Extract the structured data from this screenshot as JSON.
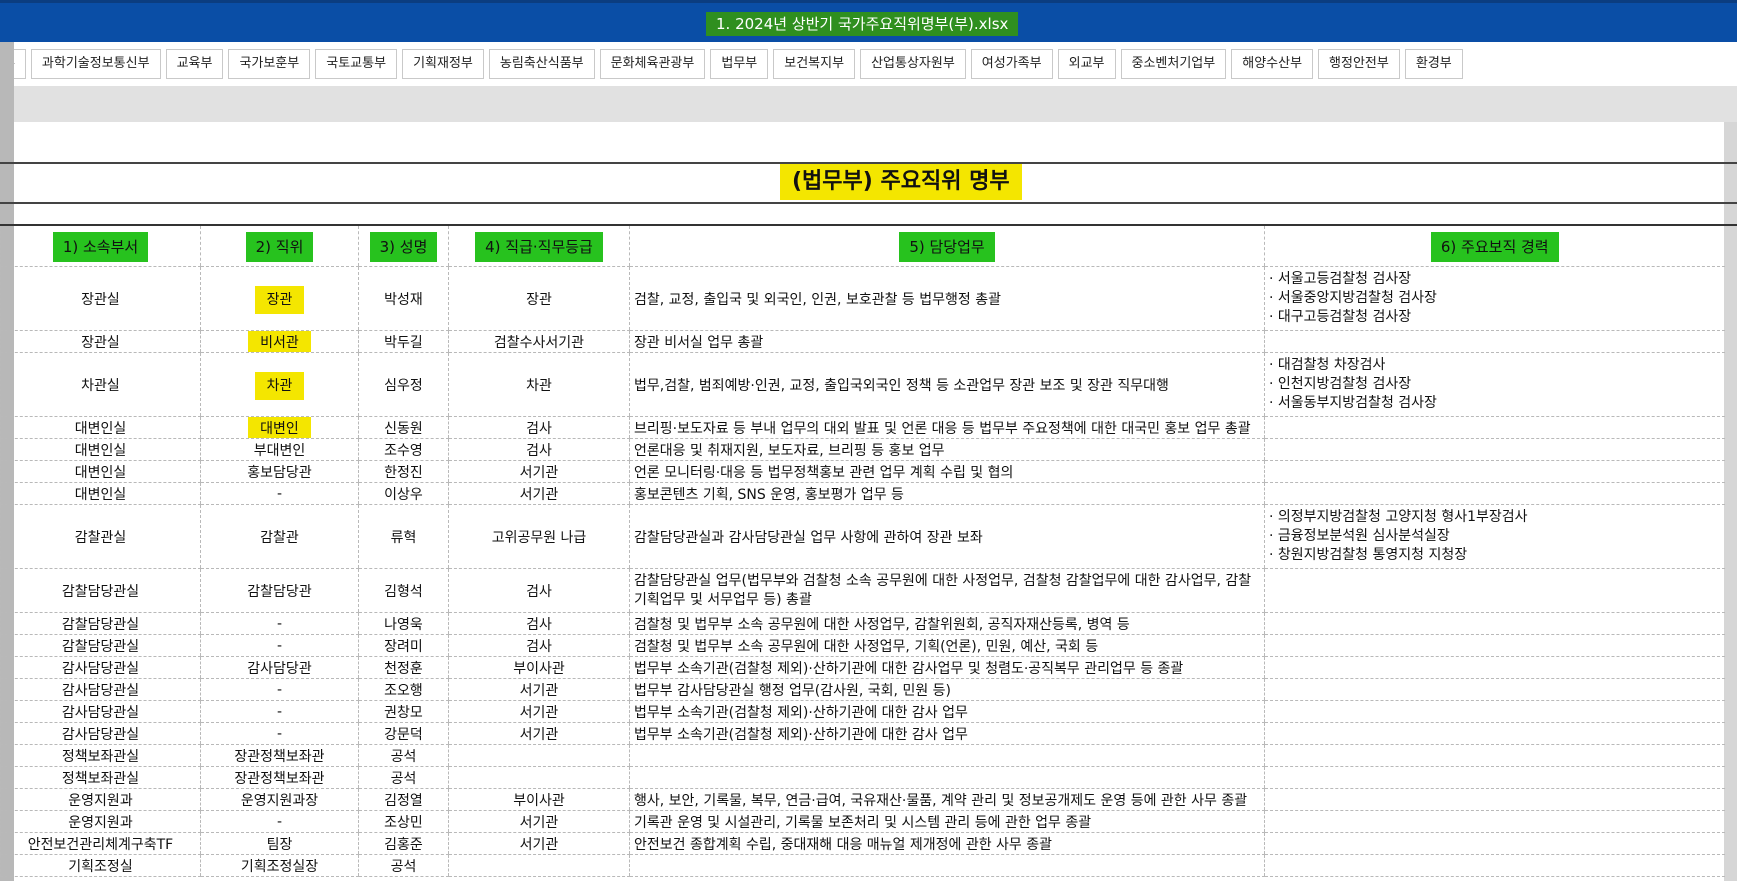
{
  "window": {
    "title": "1. 2024년 상반기 국가주요직위명부(부).xlsx"
  },
  "tabs": [
    "동부",
    "과학기술정보통신부",
    "교육부",
    "국가보훈부",
    "국토교통부",
    "기획재정부",
    "농림축산식품부",
    "문화체육관광부",
    "법무부",
    "보건복지부",
    "산업통상자원부",
    "여성가족부",
    "외교부",
    "중소벤처기업부",
    "해양수산부",
    "행정안전부",
    "환경부"
  ],
  "sheet": {
    "heading": "(법무부) 주요직위 명부"
  },
  "columns": [
    "1) 소속부서",
    "2) 직위",
    "3) 성명",
    "4) 직급·직무등급",
    "5) 담당업무",
    "6) 주요보직 경력"
  ],
  "colors": {
    "header_highlight": "#27c21e",
    "cell_highlight": "#f4e600",
    "titlebar": "#0a4ea6"
  },
  "rows": [
    {
      "dept": "장관실",
      "position": "장관",
      "name": "박성재",
      "grade": "장관",
      "duty": "검찰, 교정, 출입국 및 외국인, 인권, 보호관찰 등 법무행정 총괄",
      "career": [
        "· 서울고등검찰청 검사장",
        "· 서울중앙지방검찰청 검사장",
        "· 대구고등검찰청 검사장"
      ],
      "hl": true
    },
    {
      "dept": "장관실",
      "position": "비서관",
      "name": "박두길",
      "grade": "검찰수사서기관",
      "duty": "장관 비서실 업무 총괄",
      "career": [],
      "hl": true
    },
    {
      "dept": "차관실",
      "position": "차관",
      "name": "심우정",
      "grade": "차관",
      "duty": "법무,검찰, 범죄예방·인권, 교정, 출입국외국인 정책 등 소관업무 장관 보조 및 장관 직무대행",
      "career": [
        "· 대검찰청 차장검사",
        "· 인천지방검찰청 검사장",
        "· 서울동부지방검찰청 검사장"
      ],
      "hl": true
    },
    {
      "dept": "대변인실",
      "position": "대변인",
      "name": "신동원",
      "grade": "검사",
      "duty": "브리핑·보도자료 등 부내 업무의 대외 발표 및 언론 대응 등 법무부 주요정책에 대한 대국민 홍보 업무 총괄",
      "career": [],
      "hl": true
    },
    {
      "dept": "대변인실",
      "position": "부대변인",
      "name": "조수영",
      "grade": "검사",
      "duty": "언론대응 및 취재지원, 보도자료, 브리핑 등 홍보 업무",
      "career": []
    },
    {
      "dept": "대변인실",
      "position": "홍보담당관",
      "name": "한정진",
      "grade": "서기관",
      "duty": "언론 모니터링·대응 등 법무정책홍보 관련 업무 계획 수립 및 협의",
      "career": []
    },
    {
      "dept": "대변인실",
      "position": "-",
      "name": "이상우",
      "grade": "서기관",
      "duty": "홍보콘텐츠 기획, SNS 운영,  홍보평가 업무 등",
      "career": []
    },
    {
      "dept": "감찰관실",
      "position": "감찰관",
      "name": "류혁",
      "grade": "고위공무원 나급",
      "duty": "감찰담당관실과 감사담당관실 업무 사항에 관하여 장관 보좌",
      "career": [
        "· 의정부지방검찰청 고양지청 형사1부장검사",
        "· 금융정보분석원 심사분석실장",
        "· 창원지방검찰청 통영지청 지청장"
      ]
    },
    {
      "dept": "감찰담당관실",
      "position": "감찰담당관",
      "name": "김형석",
      "grade": "검사",
      "duty": "감찰담당관실 업무(법무부와 검찰청 소속 공무원에 대한 사정업무, 검찰청 감찰업무에 대한 감사업무, 감찰기획업무 및 서무업무 등) 총괄",
      "career": []
    },
    {
      "dept": "감찰담당관실",
      "position": "-",
      "name": "나영욱",
      "grade": "검사",
      "duty": "검찰청 및 법무부 소속 공무원에 대한 사정업무, 감찰위원회, 공직자재산등록, 병역 등",
      "career": []
    },
    {
      "dept": "감찰담당관실",
      "position": "-",
      "name": "장려미",
      "grade": "검사",
      "duty": "검찰청 및 법무부 소속 공무원에 대한 사정업무, 기획(언론), 민원, 예산, 국회 등",
      "career": []
    },
    {
      "dept": "감사담당관실",
      "position": "감사담당관",
      "name": "천정훈",
      "grade": "부이사관",
      "duty": "법무부 소속기관(검찰청 제외)·산하기관에 대한 감사업무 및 청렴도·공직복무 관리업무 등 종괄",
      "career": []
    },
    {
      "dept": "감사담당관실",
      "position": "-",
      "name": "조오행",
      "grade": "서기관",
      "duty": "법무부 감사담당관실 행정 업무(감사원, 국회, 민원 등)",
      "career": []
    },
    {
      "dept": "감사담당관실",
      "position": "-",
      "name": "권창모",
      "grade": "서기관",
      "duty": "법무부 소속기관(검찰청 제외)·산하기관에 대한 감사 업무",
      "career": []
    },
    {
      "dept": "감사담당관실",
      "position": "-",
      "name": "강문덕",
      "grade": "서기관",
      "duty": "법무부 소속기관(검찰청 제외)·산하기관에 대한 감사 업무",
      "career": []
    },
    {
      "dept": "정책보좌관실",
      "position": "장관정책보좌관",
      "name": "공석",
      "grade": "",
      "duty": "",
      "career": []
    },
    {
      "dept": "정책보좌관실",
      "position": "장관정책보좌관",
      "name": "공석",
      "grade": "",
      "duty": "",
      "career": []
    },
    {
      "dept": "운영지원과",
      "position": "운영지원과장",
      "name": "김정열",
      "grade": "부이사관",
      "duty": "행사, 보안, 기록물, 복무, 연금·급여, 국유재산·물품, 계약 관리 및 정보공개제도 운영 등에 관한 사무 종괄",
      "career": []
    },
    {
      "dept": "운영지원과",
      "position": "-",
      "name": "조상민",
      "grade": "서기관",
      "duty": "기록관 운영 및 시설관리, 기록물 보존처리 및 시스템 관리 등에 관한 업무 종괄",
      "career": []
    },
    {
      "dept": "안전보건관리체계구축TF",
      "position": "팀장",
      "name": "김홍준",
      "grade": "서기관",
      "duty": "안전보건 종합계획 수립, 중대재해 대응 매뉴얼 제개정에 관한 사무 종괄",
      "career": []
    },
    {
      "dept": "기획조정실",
      "position": "기획조정실장",
      "name": "공석",
      "grade": "",
      "duty": "",
      "career": []
    }
  ]
}
